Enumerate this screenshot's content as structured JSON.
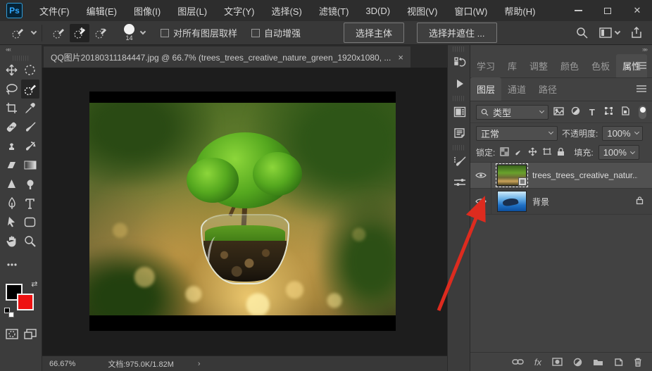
{
  "app": {
    "logo_text": "Ps"
  },
  "menu_bar": {
    "items": [
      "文件(F)",
      "编辑(E)",
      "图像(I)",
      "图层(L)",
      "文字(Y)",
      "选择(S)",
      "滤镜(T)",
      "3D(D)",
      "视图(V)",
      "窗口(W)",
      "帮助(H)"
    ]
  },
  "window_controls": {
    "minimize": "minimize",
    "maximize": "maximize",
    "close": "close"
  },
  "options_bar": {
    "tool_name": "quick-selection-tool",
    "brush_size": "14",
    "sample_all_layers_label": "对所有图层取样",
    "auto_enhance_label": "自动增强",
    "select_subject_label": "选择主体",
    "select_and_mask_label": "选择并遮住 ..."
  },
  "toolbar": {
    "collapse_glyph": "««",
    "tools": [
      "move",
      "elliptical-marquee",
      "lasso",
      "quick-selection",
      "crop",
      "eyedropper",
      "spot-healing",
      "brush",
      "clone-stamp",
      "history-brush",
      "eraser",
      "gradient",
      "sharpen",
      "dodge",
      "pen",
      "type",
      "path-selection",
      "rectangle",
      "hand",
      "zoom",
      "edit-toolbar"
    ],
    "foreground_color": "#000000",
    "background_color": "#ee1111"
  },
  "document_tab": {
    "title": "QQ图片20180311184447.jpg @ 66.7% (trees_trees_creative_nature_green_1920x1080, ...",
    "close_glyph": "×"
  },
  "right_panel": {
    "expand_glyph": "»»",
    "tab_group1": {
      "tabs": [
        "学习",
        "库",
        "调整",
        "颜色",
        "色板",
        "属性"
      ],
      "active": "属性"
    },
    "tab_group2": {
      "tabs": [
        "图层",
        "通道",
        "路径"
      ],
      "active": "图层"
    },
    "filter": {
      "label": "类型"
    },
    "blend_mode": "正常",
    "opacity_label": "不透明度:",
    "opacity_value": "100%",
    "lock_label": "锁定:",
    "fill_label": "填充:",
    "fill_value": "100%",
    "layers": [
      {
        "name": "trees_trees_creative_natur...",
        "visible": true,
        "selected": true,
        "smart_object": true
      },
      {
        "name": "背景",
        "visible": true,
        "locked": true
      }
    ],
    "bottom_bar": {
      "fx_label": "fx"
    }
  },
  "status_bar": {
    "zoom": "66.67%",
    "doc_info": "文档:975.0K/1.82M",
    "chevron": "›"
  },
  "annotation": {
    "type": "red-arrow",
    "color": "#dd2b1f",
    "points_to": "background-layer-eye-icon"
  },
  "colors": {
    "ps_blue": "#31a8ff",
    "panel_bg": "#424242",
    "pasteboard": "#1d1d1d",
    "arrow_red": "#dd2b1f"
  }
}
